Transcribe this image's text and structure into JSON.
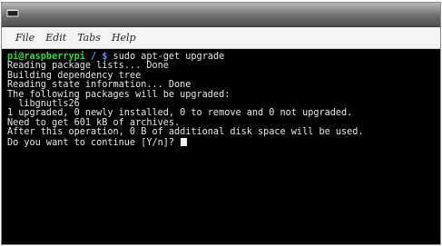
{
  "menu": {
    "items": [
      "File",
      "Edit",
      "Tabs",
      "Help"
    ]
  },
  "terminal": {
    "prompt_user": "pi@raspberrypi",
    "prompt_path": " / $",
    "command": " sudo apt-get upgrade",
    "output": [
      "Reading package lists... Done",
      "Building dependency tree",
      "Reading state information... Done",
      "The following packages will be upgraded:",
      "  libgnutls26",
      "1 upgraded, 0 newly installed, 0 to remove and 0 not upgraded.",
      "Need to get 601 kB of archives.",
      "After this operation, 0 B of additional disk space will be used.",
      "Do you want to continue [Y/n]? "
    ]
  },
  "colors": {
    "prompt_user": "#37d44a",
    "prompt_path": "#5b8cff",
    "background": "#000000",
    "text": "#e8e8e8"
  }
}
